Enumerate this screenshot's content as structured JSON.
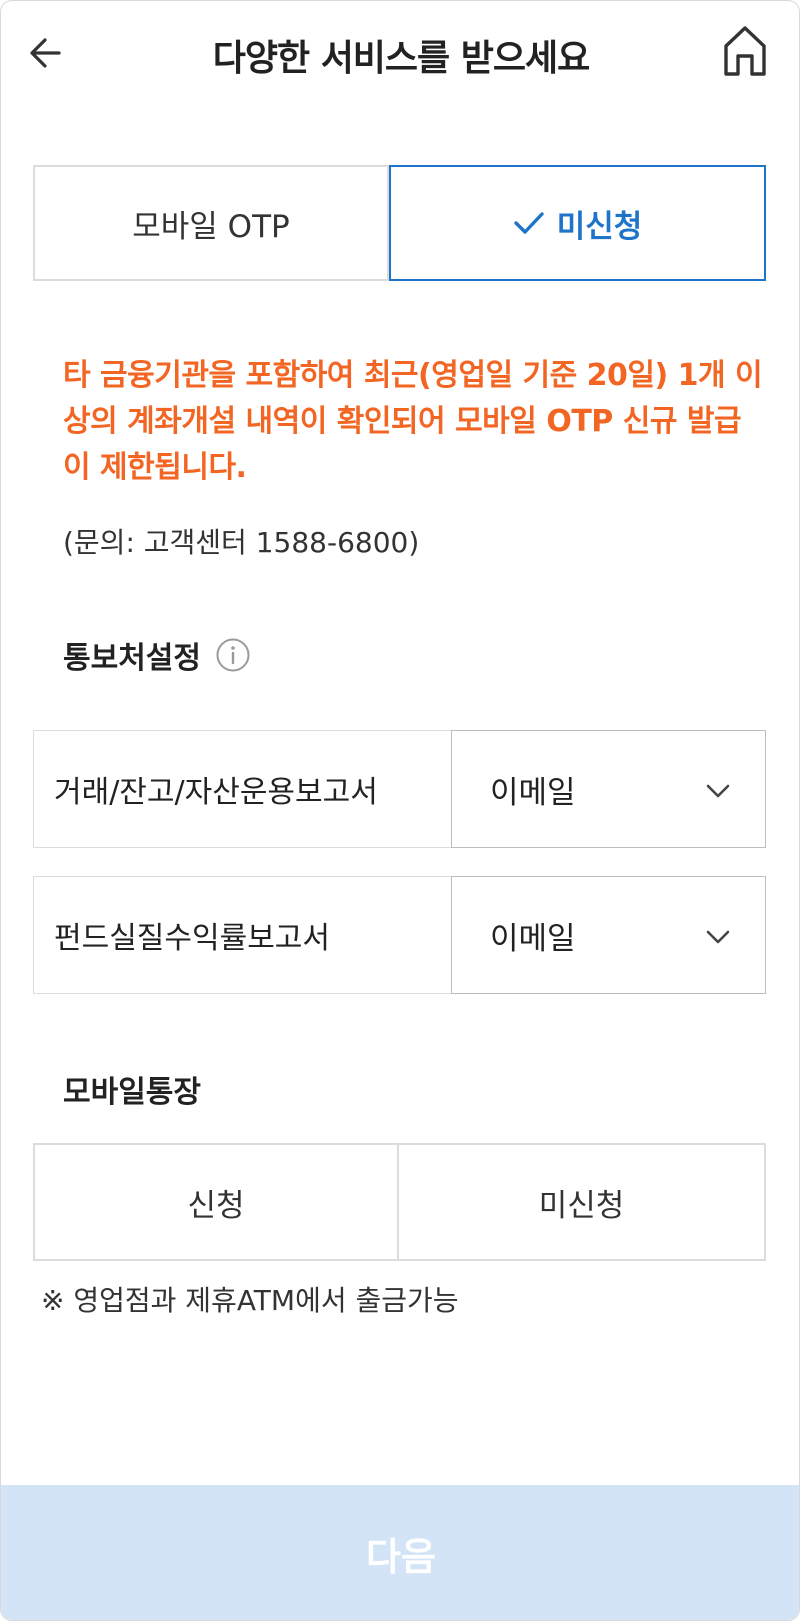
{
  "header": {
    "title": "다양한 서비스를 받으세요"
  },
  "otp": {
    "options": [
      {
        "label": "모바일 OTP"
      },
      {
        "label": "미신청"
      }
    ],
    "selected": "미신청"
  },
  "warning_text": "타 금융기관을 포함하여 최근(영업일 기준 20일) 1개 이상의 계좌개설 내역이 확인되어 모바일 OTP 신규 발급이 제한됩니다.",
  "inquiry_text": "(문의: 고객센터 1588-6800)",
  "notification": {
    "title": "통보처설정",
    "rows": [
      {
        "label": "거래/잔고/자산운용보고서",
        "value": "이메일"
      },
      {
        "label": "펀드실질수익률보고서",
        "value": "이메일"
      }
    ]
  },
  "mobile_passbook": {
    "title": "모바일통장",
    "options": [
      {
        "label": "신청"
      },
      {
        "label": "미신청"
      }
    ]
  },
  "note_text": "※ 영업점과 제휴ATM에서 출금가능",
  "next_button": "다음",
  "colors": {
    "accent": "#1e74c8",
    "warning": "#f26522",
    "disabled_button": "#d2e4f6"
  },
  "icons": [
    "back-arrow-icon",
    "home-icon",
    "check-icon",
    "info-icon",
    "chevron-down-icon"
  ]
}
